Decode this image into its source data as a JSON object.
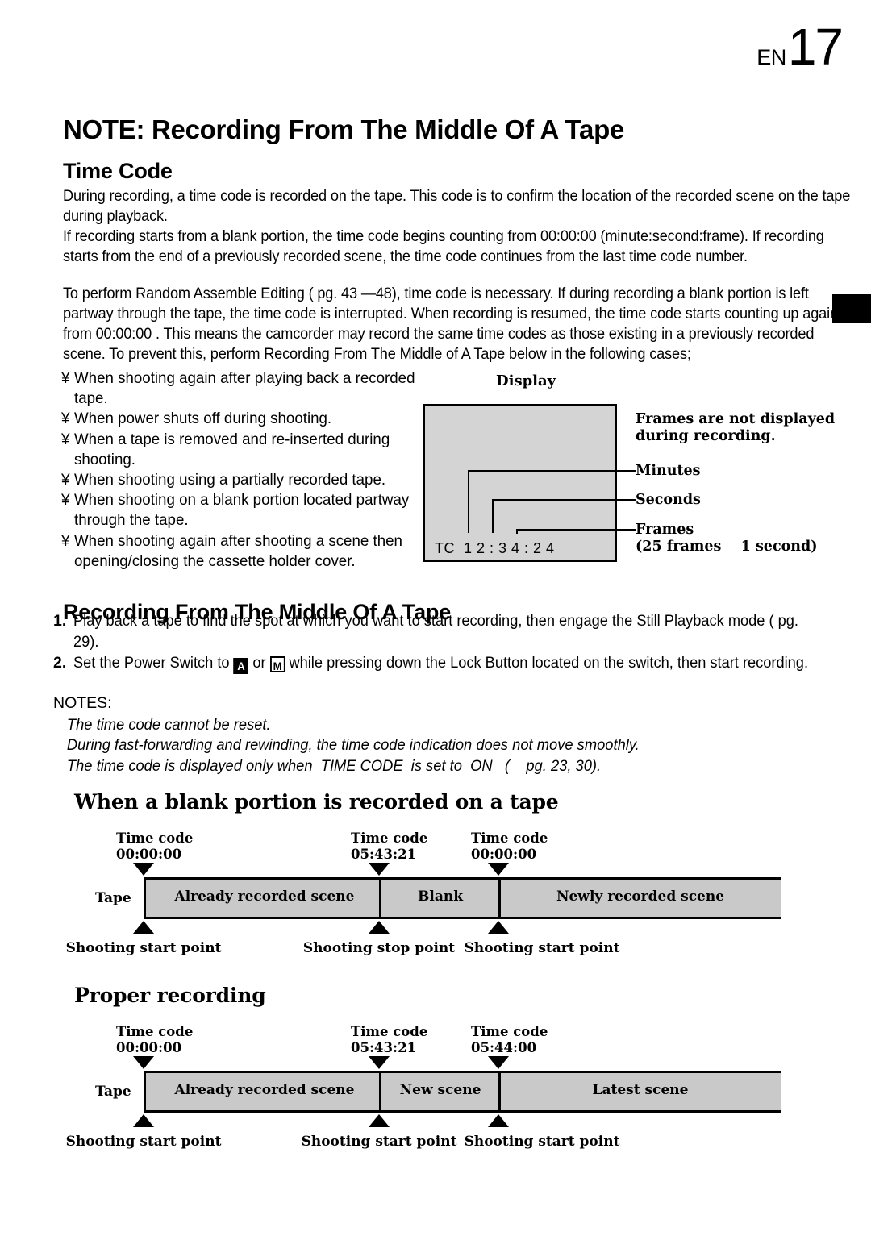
{
  "page": {
    "lang_code": "EN",
    "number": "17"
  },
  "headings": {
    "note_title": "NOTE: Recording From The Middle Of A Tape",
    "time_code": "Time Code",
    "recording_from_middle": "Recording From The Middle Of A Tape"
  },
  "paragraphs": {
    "p1": "During recording, a time code is recorded on the tape. This code is to confirm the location of the recorded scene on the tape during playback.",
    "p2": "If recording starts from a blank portion, the time code begins counting from 00:00:00 (minute:second:frame). If recording starts from the end of a previously recorded scene, the time code continues from the last time code number.",
    "p3": "To perform Random Assemble Editing ( pg. 43 —48), time code is necessary. If during recording a blank portion is left partway through the tape, the time code is interrupted. When recording is resumed, the time code starts counting up again from 00:00:00 . This means the camcorder may record the same time codes as those existing in a previously recorded scene. To prevent this, perform Recording From The Middle of A Tape  below in the following cases;"
  },
  "bullets": {
    "marker": "¥",
    "items": [
      "When shooting again after playing back a recorded tape.",
      "When power shuts off during shooting.",
      "When a tape is removed and re-inserted during shooting.",
      "When shooting using a partially recorded tape.",
      "When shooting on a blank portion located partway through the tape.",
      "When shooting again after shooting a scene then opening/closing the cassette holder cover."
    ]
  },
  "display_diagram": {
    "caption": "Display",
    "screen_text": "TC  1 2 : 3 4 : 2 4",
    "labels": {
      "frames_note": "Frames are not displayed\nduring recording.",
      "minutes": "Minutes",
      "seconds": "Seconds",
      "frames": "Frames",
      "frames_sub": "(25 frames    1 second)"
    }
  },
  "steps": [
    {
      "number": "1.",
      "text_before": "Play back a tape to find the spot at which you want to start recording, then engage the Still Playback mode (  pg. 29)."
    },
    {
      "number": "2.",
      "text_before": "Set the Power Switch to ",
      "icon_a": "A",
      "text_middle": "  or  ",
      "icon_m": "M",
      "text_after": "  while pressing down the Lock Button located on the switch, then start recording."
    }
  ],
  "notes": {
    "title": "NOTES:",
    "lines": [
      "The time code cannot be reset.",
      "During fast-forwarding and rewinding, the time code indication does not move smoothly.",
      "The time code is displayed only when  TIME CODE  is set to  ON   (    pg. 23, 30)."
    ]
  },
  "tape_diagrams": [
    {
      "title": "When a blank portion is recorded on a tape",
      "tape_word": "Tape",
      "time_codes": [
        {
          "label": "Time code",
          "value": "00:00:00"
        },
        {
          "label": "Time code",
          "value": "05:43:21"
        },
        {
          "label": "Time code",
          "value": "00:00:00"
        }
      ],
      "segments": [
        "Already recorded scene",
        "Blank",
        "Newly recorded scene"
      ],
      "point_labels": [
        "Shooting start point",
        "Shooting stop point",
        "Shooting start point"
      ]
    },
    {
      "title": "Proper recording",
      "tape_word": "Tape",
      "time_codes": [
        {
          "label": "Time code",
          "value": "00:00:00"
        },
        {
          "label": "Time code",
          "value": "05:43:21"
        },
        {
          "label": "Time code",
          "value": "05:44:00"
        }
      ],
      "segments": [
        "Already recorded scene",
        "New scene",
        "Latest scene"
      ],
      "point_labels": [
        "Shooting start point",
        "Shooting start point",
        "Shooting start point"
      ]
    }
  ],
  "colors": {
    "tape_fill": "#c9c9c9",
    "display_fill": "#d4d4d4",
    "ink": "#000000",
    "paper": "#ffffff"
  }
}
